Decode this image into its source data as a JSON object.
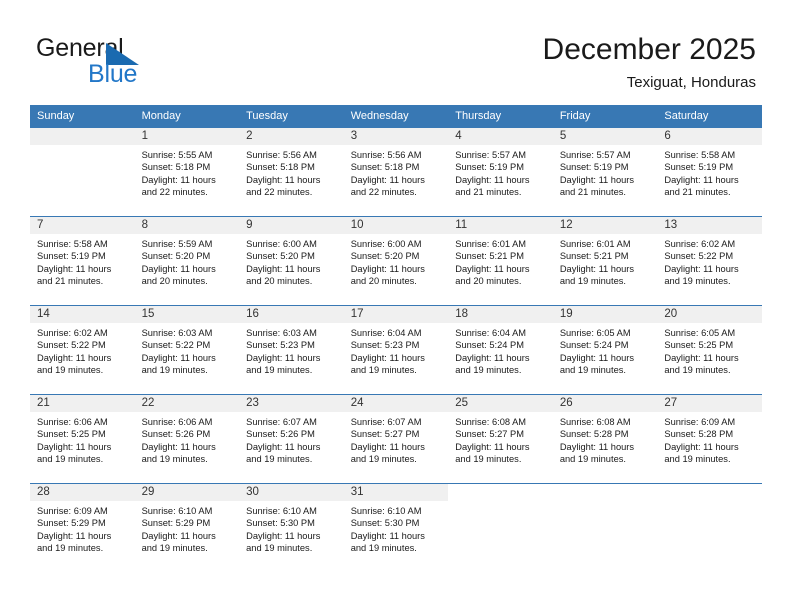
{
  "brand": {
    "name_part1": "General",
    "name_part2": "Blue",
    "flag_icon": "triangle-flag-icon",
    "color_primary": "#2277c8",
    "color_dark": "#1a1a1a"
  },
  "header": {
    "title": "December 2025",
    "subtitle": "Texiguat, Honduras"
  },
  "theme": {
    "header_bg": "#3878b4",
    "daynum_bg": "#f0f0f0",
    "cell_bg": "#ffffff",
    "text": "#1a1a1a"
  },
  "calendar": {
    "weekday_headers": [
      "Sunday",
      "Monday",
      "Tuesday",
      "Wednesday",
      "Thursday",
      "Friday",
      "Saturday"
    ],
    "weeks": [
      [
        {
          "day": "",
          "empty": true
        },
        {
          "day": "1",
          "sunrise": "Sunrise: 5:55 AM",
          "sunset": "Sunset: 5:18 PM",
          "daylight_line1": "Daylight: 11 hours",
          "daylight_line2": "and 22 minutes."
        },
        {
          "day": "2",
          "sunrise": "Sunrise: 5:56 AM",
          "sunset": "Sunset: 5:18 PM",
          "daylight_line1": "Daylight: 11 hours",
          "daylight_line2": "and 22 minutes."
        },
        {
          "day": "3",
          "sunrise": "Sunrise: 5:56 AM",
          "sunset": "Sunset: 5:18 PM",
          "daylight_line1": "Daylight: 11 hours",
          "daylight_line2": "and 22 minutes."
        },
        {
          "day": "4",
          "sunrise": "Sunrise: 5:57 AM",
          "sunset": "Sunset: 5:19 PM",
          "daylight_line1": "Daylight: 11 hours",
          "daylight_line2": "and 21 minutes."
        },
        {
          "day": "5",
          "sunrise": "Sunrise: 5:57 AM",
          "sunset": "Sunset: 5:19 PM",
          "daylight_line1": "Daylight: 11 hours",
          "daylight_line2": "and 21 minutes."
        },
        {
          "day": "6",
          "sunrise": "Sunrise: 5:58 AM",
          "sunset": "Sunset: 5:19 PM",
          "daylight_line1": "Daylight: 11 hours",
          "daylight_line2": "and 21 minutes."
        }
      ],
      [
        {
          "day": "7",
          "sunrise": "Sunrise: 5:58 AM",
          "sunset": "Sunset: 5:19 PM",
          "daylight_line1": "Daylight: 11 hours",
          "daylight_line2": "and 21 minutes."
        },
        {
          "day": "8",
          "sunrise": "Sunrise: 5:59 AM",
          "sunset": "Sunset: 5:20 PM",
          "daylight_line1": "Daylight: 11 hours",
          "daylight_line2": "and 20 minutes."
        },
        {
          "day": "9",
          "sunrise": "Sunrise: 6:00 AM",
          "sunset": "Sunset: 5:20 PM",
          "daylight_line1": "Daylight: 11 hours",
          "daylight_line2": "and 20 minutes."
        },
        {
          "day": "10",
          "sunrise": "Sunrise: 6:00 AM",
          "sunset": "Sunset: 5:20 PM",
          "daylight_line1": "Daylight: 11 hours",
          "daylight_line2": "and 20 minutes."
        },
        {
          "day": "11",
          "sunrise": "Sunrise: 6:01 AM",
          "sunset": "Sunset: 5:21 PM",
          "daylight_line1": "Daylight: 11 hours",
          "daylight_line2": "and 20 minutes."
        },
        {
          "day": "12",
          "sunrise": "Sunrise: 6:01 AM",
          "sunset": "Sunset: 5:21 PM",
          "daylight_line1": "Daylight: 11 hours",
          "daylight_line2": "and 19 minutes."
        },
        {
          "day": "13",
          "sunrise": "Sunrise: 6:02 AM",
          "sunset": "Sunset: 5:22 PM",
          "daylight_line1": "Daylight: 11 hours",
          "daylight_line2": "and 19 minutes."
        }
      ],
      [
        {
          "day": "14",
          "sunrise": "Sunrise: 6:02 AM",
          "sunset": "Sunset: 5:22 PM",
          "daylight_line1": "Daylight: 11 hours",
          "daylight_line2": "and 19 minutes."
        },
        {
          "day": "15",
          "sunrise": "Sunrise: 6:03 AM",
          "sunset": "Sunset: 5:22 PM",
          "daylight_line1": "Daylight: 11 hours",
          "daylight_line2": "and 19 minutes."
        },
        {
          "day": "16",
          "sunrise": "Sunrise: 6:03 AM",
          "sunset": "Sunset: 5:23 PM",
          "daylight_line1": "Daylight: 11 hours",
          "daylight_line2": "and 19 minutes."
        },
        {
          "day": "17",
          "sunrise": "Sunrise: 6:04 AM",
          "sunset": "Sunset: 5:23 PM",
          "daylight_line1": "Daylight: 11 hours",
          "daylight_line2": "and 19 minutes."
        },
        {
          "day": "18",
          "sunrise": "Sunrise: 6:04 AM",
          "sunset": "Sunset: 5:24 PM",
          "daylight_line1": "Daylight: 11 hours",
          "daylight_line2": "and 19 minutes."
        },
        {
          "day": "19",
          "sunrise": "Sunrise: 6:05 AM",
          "sunset": "Sunset: 5:24 PM",
          "daylight_line1": "Daylight: 11 hours",
          "daylight_line2": "and 19 minutes."
        },
        {
          "day": "20",
          "sunrise": "Sunrise: 6:05 AM",
          "sunset": "Sunset: 5:25 PM",
          "daylight_line1": "Daylight: 11 hours",
          "daylight_line2": "and 19 minutes."
        }
      ],
      [
        {
          "day": "21",
          "sunrise": "Sunrise: 6:06 AM",
          "sunset": "Sunset: 5:25 PM",
          "daylight_line1": "Daylight: 11 hours",
          "daylight_line2": "and 19 minutes."
        },
        {
          "day": "22",
          "sunrise": "Sunrise: 6:06 AM",
          "sunset": "Sunset: 5:26 PM",
          "daylight_line1": "Daylight: 11 hours",
          "daylight_line2": "and 19 minutes."
        },
        {
          "day": "23",
          "sunrise": "Sunrise: 6:07 AM",
          "sunset": "Sunset: 5:26 PM",
          "daylight_line1": "Daylight: 11 hours",
          "daylight_line2": "and 19 minutes."
        },
        {
          "day": "24",
          "sunrise": "Sunrise: 6:07 AM",
          "sunset": "Sunset: 5:27 PM",
          "daylight_line1": "Daylight: 11 hours",
          "daylight_line2": "and 19 minutes."
        },
        {
          "day": "25",
          "sunrise": "Sunrise: 6:08 AM",
          "sunset": "Sunset: 5:27 PM",
          "daylight_line1": "Daylight: 11 hours",
          "daylight_line2": "and 19 minutes."
        },
        {
          "day": "26",
          "sunrise": "Sunrise: 6:08 AM",
          "sunset": "Sunset: 5:28 PM",
          "daylight_line1": "Daylight: 11 hours",
          "daylight_line2": "and 19 minutes."
        },
        {
          "day": "27",
          "sunrise": "Sunrise: 6:09 AM",
          "sunset": "Sunset: 5:28 PM",
          "daylight_line1": "Daylight: 11 hours",
          "daylight_line2": "and 19 minutes."
        }
      ],
      [
        {
          "day": "28",
          "sunrise": "Sunrise: 6:09 AM",
          "sunset": "Sunset: 5:29 PM",
          "daylight_line1": "Daylight: 11 hours",
          "daylight_line2": "and 19 minutes."
        },
        {
          "day": "29",
          "sunrise": "Sunrise: 6:10 AM",
          "sunset": "Sunset: 5:29 PM",
          "daylight_line1": "Daylight: 11 hours",
          "daylight_line2": "and 19 minutes."
        },
        {
          "day": "30",
          "sunrise": "Sunrise: 6:10 AM",
          "sunset": "Sunset: 5:30 PM",
          "daylight_line1": "Daylight: 11 hours",
          "daylight_line2": "and 19 minutes."
        },
        {
          "day": "31",
          "sunrise": "Sunrise: 6:10 AM",
          "sunset": "Sunset: 5:30 PM",
          "daylight_line1": "Daylight: 11 hours",
          "daylight_line2": "and 19 minutes."
        },
        {
          "day": "",
          "empty": true,
          "blank": true
        },
        {
          "day": "",
          "empty": true,
          "blank": true
        },
        {
          "day": "",
          "empty": true,
          "blank": true
        }
      ]
    ]
  }
}
